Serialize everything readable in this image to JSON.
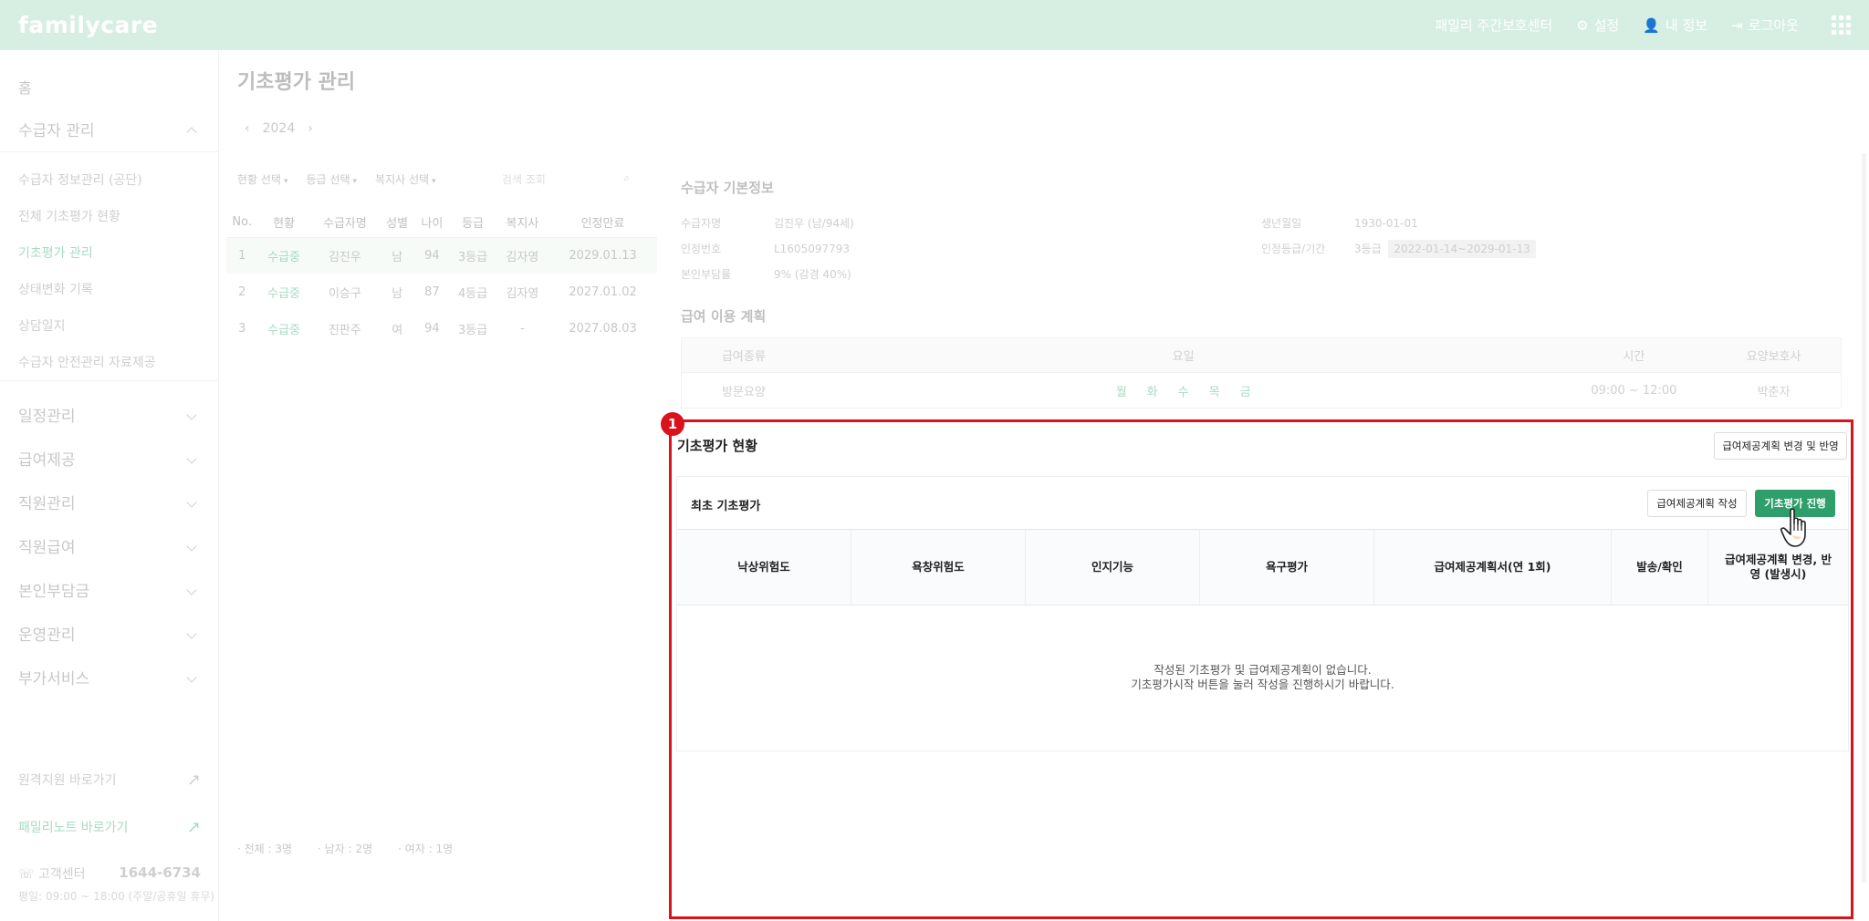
{
  "topbar": {
    "logo": "familycare",
    "center_name": "패밀리 주간보호센터",
    "settings": "설정",
    "my_info": "내 정보",
    "logout": "로그아웃"
  },
  "sidebar": {
    "home": "홈",
    "recipient_group": "수급자 관리",
    "recipient_items": [
      "수급자 정보관리 (공단)",
      "전체 기초평가 현황",
      "기초평가 관리",
      "상태변화 기록",
      "상담일지",
      "수급자 안전관리 자료제공"
    ],
    "groups": [
      "일정관리",
      "급여제공",
      "직원관리",
      "직원급여",
      "본인부담금",
      "운영관리",
      "부가서비스"
    ],
    "remote_support": "원격지원 바로가기",
    "family_note": "패밀리노트 바로가기",
    "customer_center": "고객센터",
    "phone": "1644-6734",
    "hours": "평일: 09:00 ~ 18:00 (주말/공휴일 휴무)"
  },
  "page": {
    "title": "기초평가 관리",
    "year": "2024"
  },
  "filters": {
    "status": "현황 선택",
    "grade": "등급 선택",
    "social_worker": "복지사 선택",
    "search_placeholder": "검색 조회"
  },
  "list": {
    "headers": [
      "No.",
      "현황",
      "수급자명",
      "성별",
      "나이",
      "등급",
      "복지사",
      "인정만료"
    ],
    "rows": [
      [
        "1",
        "수급중",
        "김진우",
        "남",
        "94",
        "3등급",
        "김자영",
        "2029.01.13"
      ],
      [
        "2",
        "수급중",
        "이승구",
        "남",
        "87",
        "4등급",
        "김자영",
        "2027.01.02"
      ],
      [
        "3",
        "수급중",
        "진판주",
        "여",
        "94",
        "3등급",
        "-",
        "2027.08.03"
      ]
    ],
    "summary": {
      "total": "전체 : 3명",
      "male": "남자 : 2명",
      "female": "여자 : 1명"
    }
  },
  "detail": {
    "title": "수급자 기본정보",
    "name_label": "수급자명",
    "name_value": "김진우 (남/94세)",
    "cert_no_label": "인정번호",
    "cert_no_value": "L1605097793",
    "copay_label": "본인부담률",
    "copay_value": "9% (감경 40%)",
    "birth_label": "생년월일",
    "birth_value": "1930-01-01",
    "grade_label": "인정등급/기간",
    "grade_value": "3등급",
    "period_value": "2022-01-14~2029-01-13",
    "plan_title": "급여 이용 계획",
    "plan_headers": [
      "급여종류",
      "요일",
      "시간",
      "요양보호사"
    ],
    "plan_row": {
      "type": "방문요양",
      "days": [
        "월",
        "화",
        "수",
        "목",
        "금"
      ],
      "time": "09:00 ~ 12:00",
      "caregiver": "박춘자"
    }
  },
  "eval_section": {
    "badge": "1",
    "title": "기초평가 현황",
    "change_button": "급여제공계획 변경 및 반영",
    "card_title": "최초 기초평가",
    "write_plan_button": "급여제공계획 작성",
    "start_button": "기초평가 진행",
    "columns": [
      "낙상위험도",
      "욕창위험도",
      "인지기능",
      "욕구평가",
      "급여제공계획서(연 1회)",
      "발송/확인",
      "급여제공계획 변경, 반영 (발생시)"
    ],
    "empty_line1": "작성된 기초평가 및 급여제공계획이 없습니다.",
    "empty_line2": "기초평가시작 버튼을 눌러 작성을 진행하시기 바랍니다."
  },
  "colors": {
    "topbar": "#d6efe2",
    "accent_green": "#2e9e6b",
    "highlight_red": "#d9121b"
  }
}
